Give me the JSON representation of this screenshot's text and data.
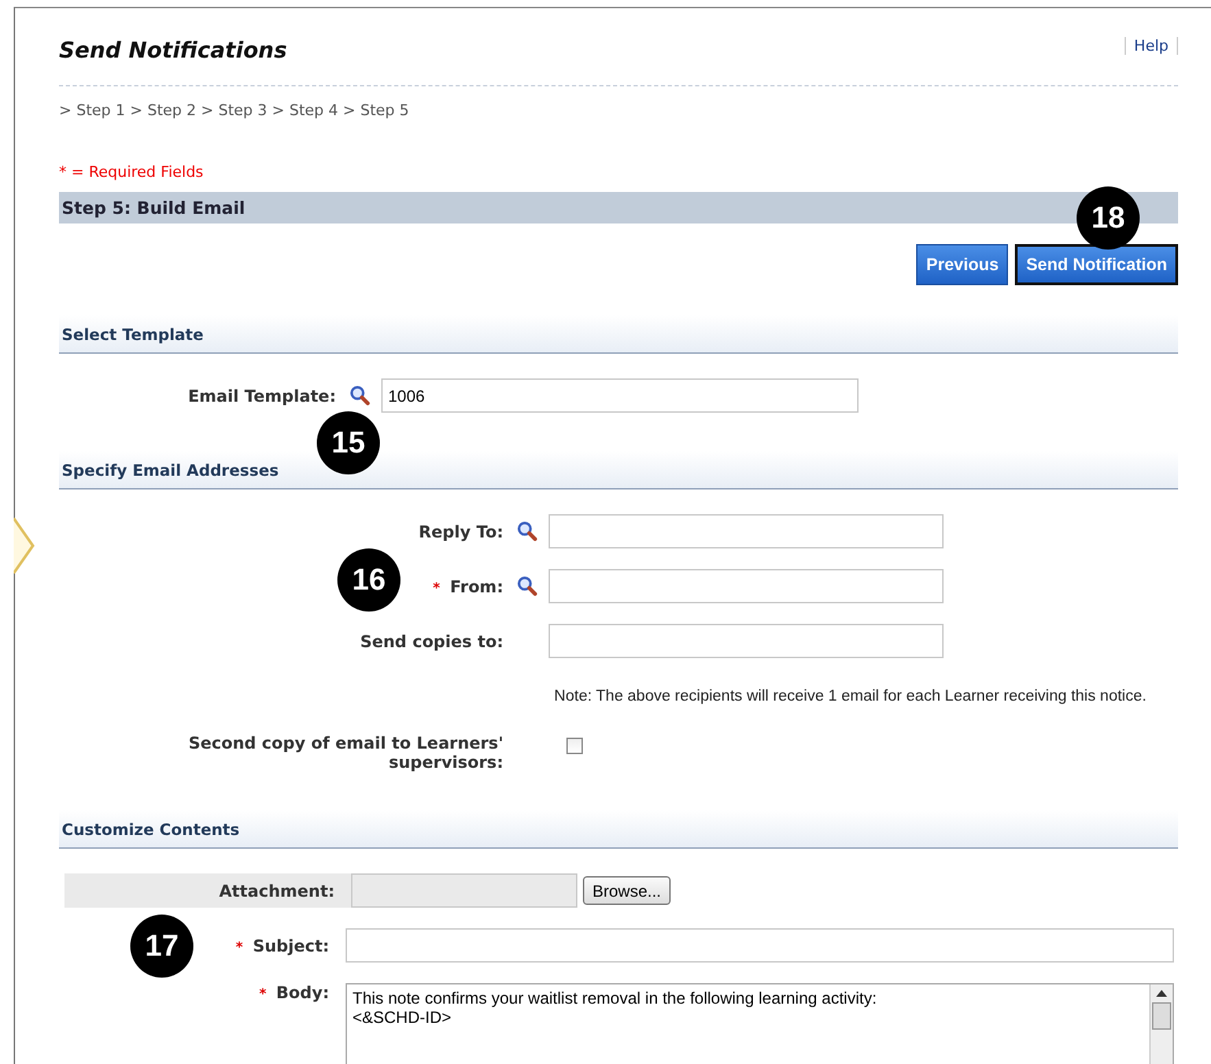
{
  "title": "Send Notifications",
  "help_link": "Help",
  "breadcrumb": "> Step 1 > Step 2 > Step 3 > Step 4 > Step 5",
  "required_note": "* = Required Fields",
  "step_header": "Step 5: Build Email",
  "buttons": [
    {
      "label": "Previous",
      "selected": false
    },
    {
      "label": "Send Notification",
      "selected": true
    }
  ],
  "sections": [
    {
      "title": "Select Template",
      "fields": [
        {
          "kind": "lookup",
          "label": "Email Template:",
          "value": "1006"
        }
      ]
    },
    {
      "title": "Specify Email Addresses",
      "fields": [
        {
          "kind": "lookup",
          "label": "Reply To:"
        },
        {
          "kind": "lookup",
          "label": "From:",
          "required_mark": "*"
        },
        {
          "kind": "text",
          "label": "Send copies to:"
        },
        {
          "kind": "note",
          "text": "Note: The above recipients will receive 1 email for each Learner receiving this notice."
        },
        {
          "kind": "checkbox",
          "label": "Second copy of email to Learners' supervisors:",
          "checked": false
        }
      ]
    },
    {
      "title": "Customize Contents",
      "fields": [
        {
          "kind": "file",
          "label": "Attachment:",
          "button": "Browse..."
        },
        {
          "kind": "text",
          "label": "Subject:",
          "required_mark": "*"
        },
        {
          "kind": "textarea",
          "label": "Body:",
          "required_mark": "*",
          "lines": [
            "This note confirms your waitlist removal in the following learning activity:",
            "<&SCHD-ID>"
          ]
        }
      ]
    }
  ],
  "callouts": [
    "18",
    "15",
    "16",
    "17"
  ]
}
